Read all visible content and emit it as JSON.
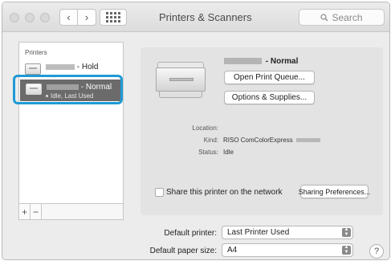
{
  "window": {
    "title": "Printers & Scanners",
    "search_placeholder": "Search"
  },
  "nav": {
    "back_glyph": "‹",
    "forward_glyph": "›"
  },
  "printers": {
    "header": "Printers",
    "items": [
      {
        "name_suffix": "- Hold",
        "selected": false
      },
      {
        "name_suffix": "- Normal",
        "status": "Idle, Last Used",
        "selected": true
      }
    ],
    "add_glyph": "+",
    "remove_glyph": "−"
  },
  "details": {
    "name_suffix": "- Normal",
    "open_queue_label": "Open Print Queue...",
    "options_label": "Options & Supplies...",
    "location_label": "Location:",
    "location_value": "",
    "kind_label": "Kind:",
    "kind_value": "RISO ComColorExpress",
    "status_label": "Status:",
    "status_value": "Idle",
    "share_label": "Share this printer on the network",
    "share_checked": false,
    "sharing_prefs_label": "Sharing Preferences..."
  },
  "defaults": {
    "printer_label": "Default printer:",
    "printer_value": "Last Printer Used",
    "paper_label": "Default paper size:",
    "paper_value": "A4"
  },
  "help_glyph": "?",
  "colors": {
    "selection": "#6b6b6b",
    "highlight_ring": "#1f9ad6",
    "panel": "#e3e3e3"
  },
  "icons": [
    "search-icon",
    "printer-icon",
    "help-icon",
    "popup-arrows-icon",
    "grid-icon"
  ]
}
